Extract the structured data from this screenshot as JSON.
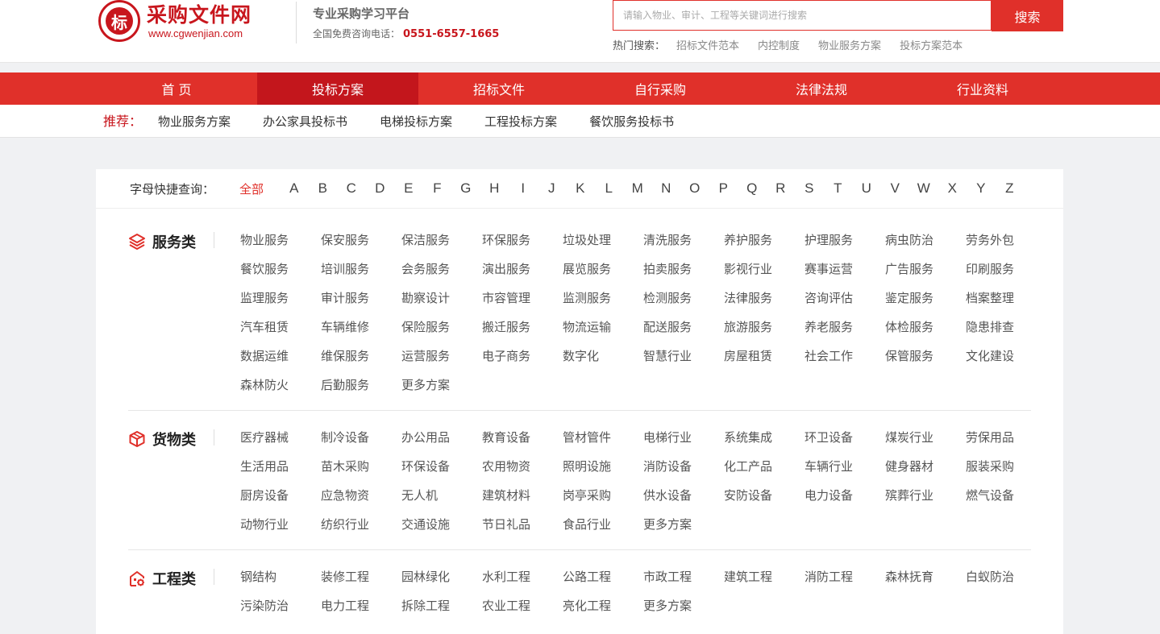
{
  "header": {
    "logo_char": "标",
    "site_name": "采购文件网",
    "site_url": "www.cgwenjian.com",
    "slogan": "专业采购学习平台",
    "hotline_label": "全国免费咨询电话：",
    "hotline_number": "0551-6557-1665"
  },
  "search": {
    "placeholder": "请输入物业、审计、工程等关键词进行搜索",
    "button": "搜索",
    "hot_label": "热门搜索：",
    "hot_items": [
      "招标文件范本",
      "内控制度",
      "物业服务方案",
      "投标方案范本"
    ]
  },
  "nav": {
    "items": [
      "首 页",
      "投标方案",
      "招标文件",
      "自行采购",
      "法律法规",
      "行业资料"
    ],
    "active_index": 1
  },
  "recommend": {
    "label": "推荐：",
    "items": [
      "物业服务方案",
      "办公家具投标书",
      "电梯投标方案",
      "工程投标方案",
      "餐饮服务投标书"
    ]
  },
  "letters": {
    "label": "字母快捷查询：",
    "all": "全部",
    "items": [
      "A",
      "B",
      "C",
      "D",
      "E",
      "F",
      "G",
      "H",
      "I",
      "J",
      "K",
      "L",
      "M",
      "N",
      "O",
      "P",
      "Q",
      "R",
      "S",
      "T",
      "U",
      "V",
      "W",
      "X",
      "Y",
      "Z"
    ]
  },
  "categories": [
    {
      "title": "服务类",
      "icon": "layers-icon",
      "items": [
        "物业服务",
        "保安服务",
        "保洁服务",
        "环保服务",
        "垃圾处理",
        "清洗服务",
        "养护服务",
        "护理服务",
        "病虫防治",
        "劳务外包",
        "餐饮服务",
        "培训服务",
        "会务服务",
        "演出服务",
        "展览服务",
        "拍卖服务",
        "影视行业",
        "赛事运营",
        "广告服务",
        "印刷服务",
        "监理服务",
        "审计服务",
        "勘察设计",
        "市容管理",
        "监测服务",
        "检测服务",
        "法律服务",
        "咨询评估",
        "鉴定服务",
        "档案整理",
        "汽车租赁",
        "车辆维修",
        "保险服务",
        "搬迁服务",
        "物流运输",
        "配送服务",
        "旅游服务",
        "养老服务",
        "体检服务",
        "隐患排查",
        "数据运维",
        "维保服务",
        "运营服务",
        "电子商务",
        "数字化",
        "智慧行业",
        "房屋租赁",
        "社会工作",
        "保管服务",
        "文化建设",
        "森林防火",
        "后勤服务",
        "更多方案"
      ]
    },
    {
      "title": "货物类",
      "icon": "box-icon",
      "items": [
        "医疗器械",
        "制冷设备",
        "办公用品",
        "教育设备",
        "管材管件",
        "电梯行业",
        "系统集成",
        "环卫设备",
        "煤炭行业",
        "劳保用品",
        "生活用品",
        "苗木采购",
        "环保设备",
        "农用物资",
        "照明设施",
        "消防设备",
        "化工产品",
        "车辆行业",
        "健身器材",
        "服装采购",
        "厨房设备",
        "应急物资",
        "无人机",
        "建筑材料",
        "岗亭采购",
        "供水设备",
        "安防设备",
        "电力设备",
        "殡葬行业",
        "燃气设备",
        "动物行业",
        "纺织行业",
        "交通设施",
        "节日礼品",
        "食品行业",
        "更多方案"
      ]
    },
    {
      "title": "工程类",
      "icon": "building-gear-icon",
      "items": [
        "钢结构",
        "装修工程",
        "园林绿化",
        "水利工程",
        "公路工程",
        "市政工程",
        "建筑工程",
        "消防工程",
        "森林抚育",
        "白蚁防治",
        "污染防治",
        "电力工程",
        "拆除工程",
        "农业工程",
        "亮化工程",
        "更多方案"
      ]
    }
  ],
  "colors": {
    "brand": "#e0302a",
    "brand_dark": "#c3161c"
  }
}
